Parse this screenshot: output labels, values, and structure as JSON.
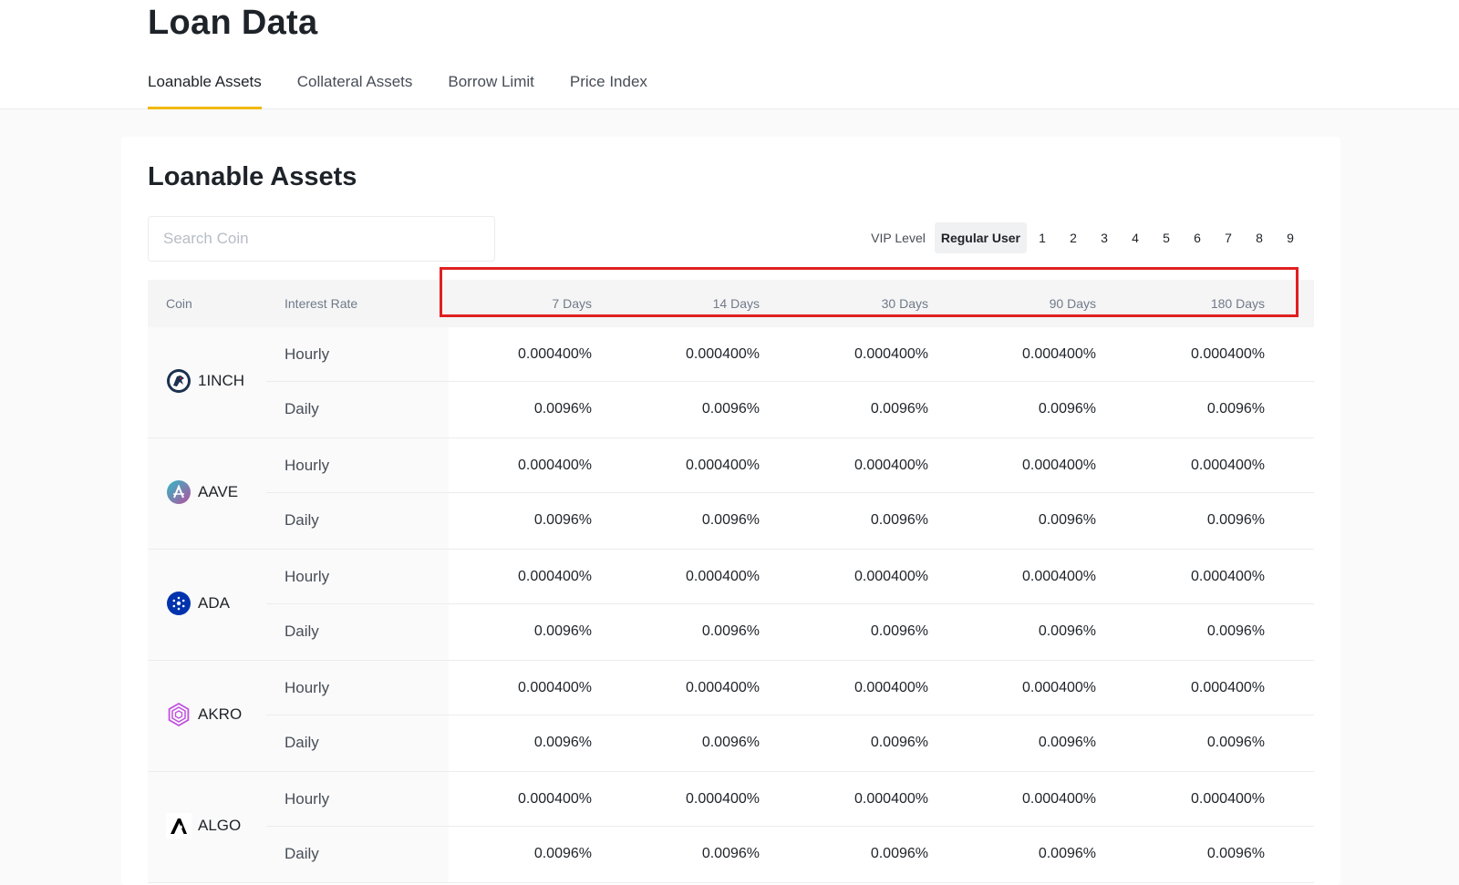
{
  "header": {
    "title": "Loan Data",
    "tabs": [
      {
        "label": "Loanable Assets",
        "active": true
      },
      {
        "label": "Collateral Assets",
        "active": false
      },
      {
        "label": "Borrow Limit",
        "active": false
      },
      {
        "label": "Price Index",
        "active": false
      }
    ]
  },
  "card": {
    "title": "Loanable Assets",
    "search": {
      "placeholder": "Search Coin",
      "value": ""
    },
    "vip": {
      "label": "VIP Level",
      "options": [
        "Regular User",
        "1",
        "2",
        "3",
        "4",
        "5",
        "6",
        "7",
        "8",
        "9"
      ],
      "selected": "Regular User"
    }
  },
  "table": {
    "headers": {
      "coin": "Coin",
      "interest_rate": "Interest Rate",
      "terms": [
        "7 Days",
        "14 Days",
        "30 Days",
        "90 Days",
        "180 Days"
      ]
    },
    "rows": [
      {
        "coin": "1INCH",
        "icon": "1inch-icon",
        "hourly_label": "Hourly",
        "daily_label": "Daily",
        "hourly": [
          "0.000400%",
          "0.000400%",
          "0.000400%",
          "0.000400%",
          "0.000400%"
        ],
        "daily": [
          "0.0096%",
          "0.0096%",
          "0.0096%",
          "0.0096%",
          "0.0096%"
        ]
      },
      {
        "coin": "AAVE",
        "icon": "aave-icon",
        "hourly_label": "Hourly",
        "daily_label": "Daily",
        "hourly": [
          "0.000400%",
          "0.000400%",
          "0.000400%",
          "0.000400%",
          "0.000400%"
        ],
        "daily": [
          "0.0096%",
          "0.0096%",
          "0.0096%",
          "0.0096%",
          "0.0096%"
        ]
      },
      {
        "coin": "ADA",
        "icon": "ada-icon",
        "hourly_label": "Hourly",
        "daily_label": "Daily",
        "hourly": [
          "0.000400%",
          "0.000400%",
          "0.000400%",
          "0.000400%",
          "0.000400%"
        ],
        "daily": [
          "0.0096%",
          "0.0096%",
          "0.0096%",
          "0.0096%",
          "0.0096%"
        ]
      },
      {
        "coin": "AKRO",
        "icon": "akro-icon",
        "hourly_label": "Hourly",
        "daily_label": "Daily",
        "hourly": [
          "0.000400%",
          "0.000400%",
          "0.000400%",
          "0.000400%",
          "0.000400%"
        ],
        "daily": [
          "0.0096%",
          "0.0096%",
          "0.0096%",
          "0.0096%",
          "0.0096%"
        ]
      },
      {
        "coin": "ALGO",
        "icon": "algo-icon",
        "hourly_label": "Hourly",
        "daily_label": "Daily",
        "hourly": [
          "0.000400%",
          "0.000400%",
          "0.000400%",
          "0.000400%",
          "0.000400%"
        ],
        "daily": [
          "0.0096%",
          "0.0096%",
          "0.0096%",
          "0.0096%",
          "0.0096%"
        ]
      }
    ]
  },
  "colors": {
    "accent": "#f0b90b",
    "highlight_box": "#e02020",
    "text_primary": "#1e2329",
    "text_secondary": "#707a8a"
  }
}
